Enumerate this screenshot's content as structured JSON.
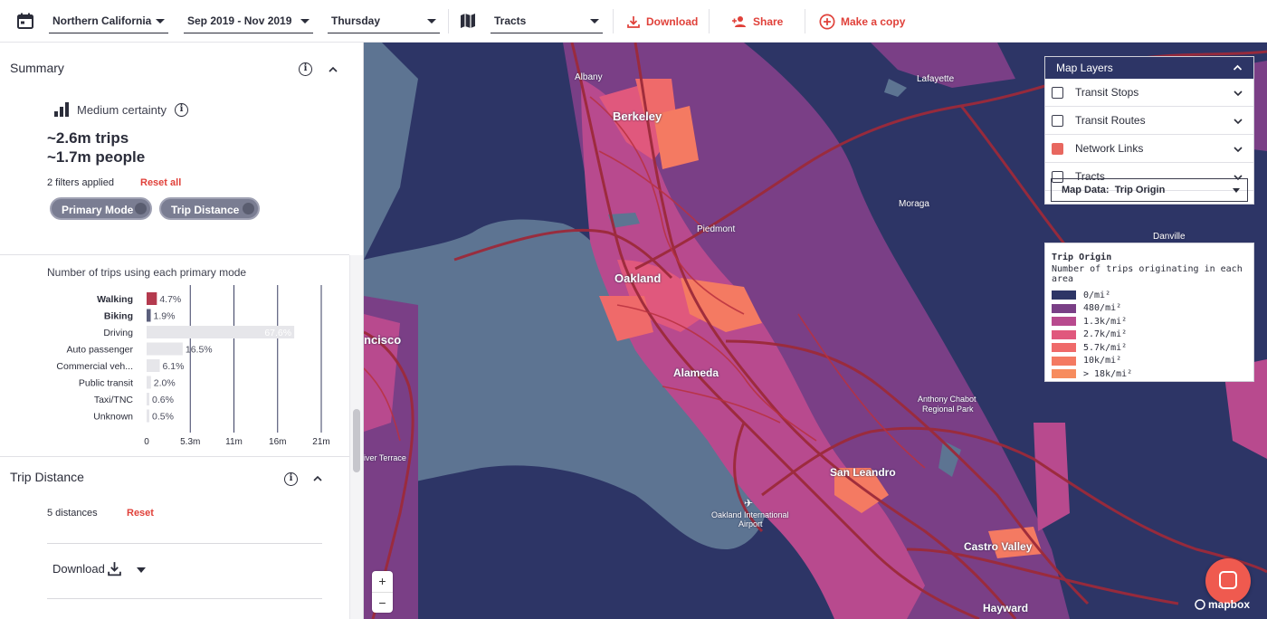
{
  "toolbar": {
    "region": "Northern California",
    "date_range": "Sep 2019 - Nov 2019",
    "day": "Thursday",
    "geography": "Tracts",
    "download": "Download",
    "share": "Share",
    "make_copy": "Make a copy"
  },
  "summary": {
    "title": "Summary",
    "certainty": "Medium certainty",
    "trips": "~2.6m trips",
    "people": "~1.7m people",
    "filters_applied": "2 filters applied",
    "reset_all": "Reset all",
    "chips": [
      "Primary Mode",
      "Trip Distance"
    ]
  },
  "mode_chart": {
    "title": "Number of trips using each primary mode",
    "chart_data": {
      "type": "bar",
      "orientation": "horizontal",
      "categories": [
        "Walking",
        "Biking",
        "Driving",
        "Auto passenger",
        "Commercial veh...",
        "Public transit",
        "Taxi/TNC",
        "Unknown"
      ],
      "values_pct": [
        "4.7%",
        "1.9%",
        "67.6%",
        "16.5%",
        "6.1%",
        "2.0%",
        "0.6%",
        "0.5%"
      ],
      "values": [
        1.25,
        0.5,
        18.0,
        4.4,
        1.6,
        0.53,
        0.16,
        0.13
      ],
      "selected": [
        "Walking",
        "Biking"
      ],
      "xticks": [
        "0",
        "5.3m",
        "11m",
        "16m",
        "21m"
      ],
      "xlim": [
        0,
        21.3
      ],
      "selected_color": "#b43a4e",
      "selected_alt_color": "#5b5f7c",
      "unselected_color": "#e6e6ea"
    }
  },
  "trip_distance": {
    "title": "Trip Distance",
    "count": "5 distances",
    "reset": "Reset",
    "download": "Download"
  },
  "layers": {
    "title": "Map Layers",
    "items": [
      {
        "label": "Transit Stops",
        "checked": false
      },
      {
        "label": "Transit Routes",
        "checked": false
      },
      {
        "label": "Network Links",
        "checked": true
      },
      {
        "label": "Tracts",
        "checked": false
      }
    ],
    "map_data_label": "Map Data:",
    "map_data_value": "Trip Origin"
  },
  "legend": {
    "title": "Trip Origin",
    "subtitle": "Number of trips originating in each area",
    "items": [
      {
        "label": "0/mi²",
        "color": "#2d3566"
      },
      {
        "label": "480/mi²",
        "color": "#7a3f86"
      },
      {
        "label": "1.3k/mi²",
        "color": "#b84a8e"
      },
      {
        "label": "2.7k/mi²",
        "color": "#e0587d"
      },
      {
        "label": "5.7k/mi²",
        "color": "#ef6a6a"
      },
      {
        "label": "10k/mi²",
        "color": "#f47a62"
      },
      {
        "label": "> 18k/mi²",
        "color": "#f78c5e"
      }
    ]
  },
  "places": {
    "albany": "Albany",
    "berkeley": "Berkeley",
    "lafayette": "Lafayette",
    "piedmont": "Piedmont",
    "moraga": "Moraga",
    "danville": "Danville",
    "oakland": "Oakland",
    "sf": "ncisco",
    "alameda": "Alameda",
    "chabot": "Anthony Chabot",
    "chabot2": "Regional Park",
    "river_terrace": "iver Terrace",
    "san_leandro": "San Leandro",
    "airport": "Oakland International",
    "airport2": "Airport",
    "castro_valley": "Castro Valley",
    "hayward": "Hayward"
  },
  "map_controls": {
    "zoom_in": "+",
    "zoom_out": "−",
    "attribution": "mapbox"
  }
}
